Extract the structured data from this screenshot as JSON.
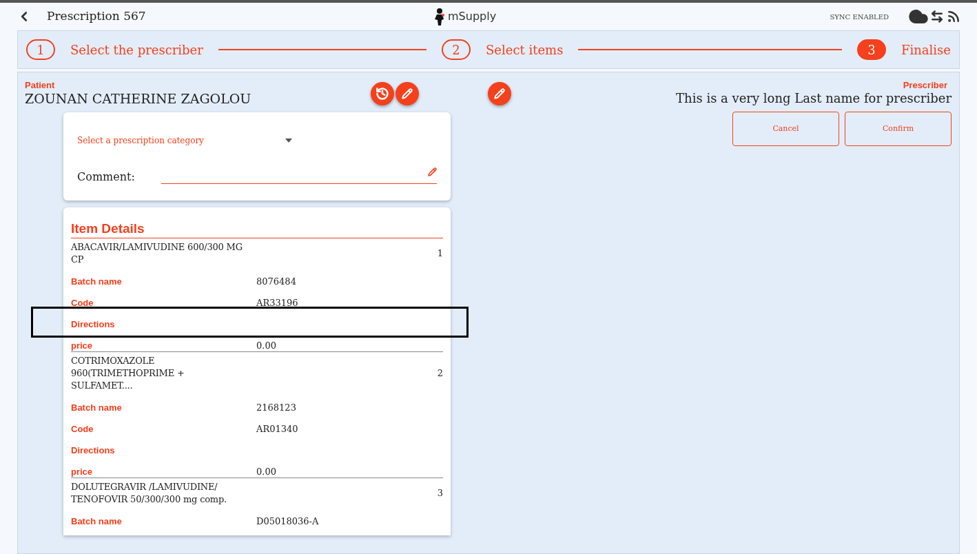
{
  "header": {
    "title": "Prescription 567",
    "logo_text": "mSupply",
    "sync_status": "SYNC ENABLED"
  },
  "steps": [
    {
      "number": "1",
      "label": "Select the prescriber",
      "selected": false
    },
    {
      "number": "2",
      "label": "Select items",
      "selected": false
    },
    {
      "number": "3",
      "label": "Finalise",
      "selected": true
    }
  ],
  "patient": {
    "label": "Patient",
    "name": "ZOUNAN CATHERINE ZAGOLOU"
  },
  "prescriber": {
    "label": "Prescriber",
    "name": "This is a very long Last name for prescriber"
  },
  "buttons": [
    "Cancel",
    "Confirm"
  ],
  "category": {
    "placeholder": "Select a prescription category"
  },
  "comment": {
    "label": "Comment:"
  },
  "item_details": {
    "title": "Item Details",
    "items": [
      {
        "name": "ABACAVIR/LAMIVUDINE 600/300 MG CP",
        "quantity": "1",
        "fields": [
          {
            "label": "Batch name",
            "value": "8076484"
          },
          {
            "label": "Code",
            "value": "AR33196"
          },
          {
            "label": "Directions"
          },
          {
            "label": "price",
            "value": "0.00"
          }
        ]
      },
      {
        "name": "COTRIMOXAZOLE 960(TRIMETHOPRIME + SULFAMET....",
        "quantity": "2",
        "fields": [
          {
            "label": "Batch name",
            "value": "2168123"
          },
          {
            "label": "Code",
            "value": "AR01340"
          },
          {
            "label": "Directions"
          },
          {
            "label": "price",
            "value": "0.00"
          }
        ]
      },
      {
        "name": "DOLUTEGRAVIR /LAMIVUDINE/ TENOFOVIR 50/300/300 mg comp.",
        "quantity": "3",
        "fields": [
          {
            "label": "Batch name",
            "value": "D05018036-A"
          }
        ]
      }
    ]
  }
}
